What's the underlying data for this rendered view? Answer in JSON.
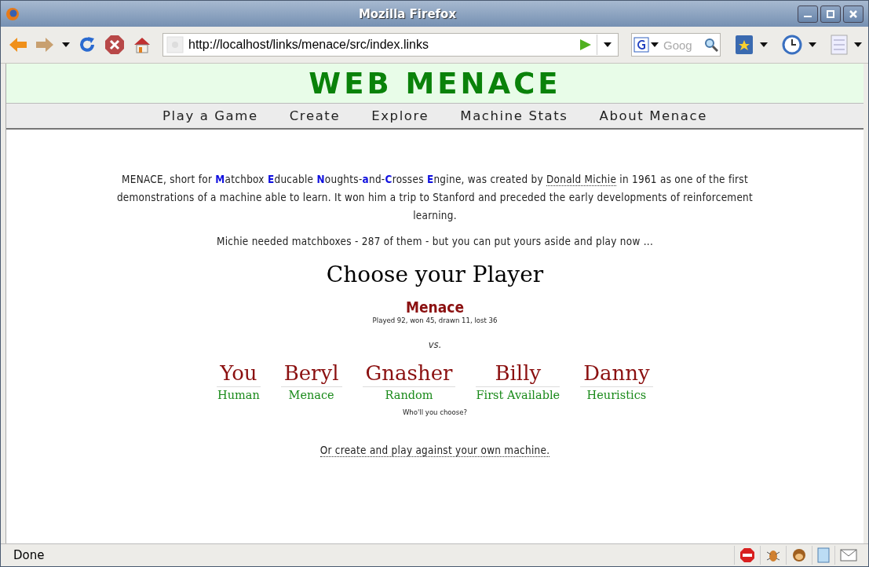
{
  "window": {
    "title": "Mozilla Firefox"
  },
  "toolbar": {
    "url": "http://localhost/links/menace/src/index.links",
    "search_placeholder": "Goog"
  },
  "site": {
    "title": "WEB MENACE"
  },
  "nav": [
    "Play a Game",
    "Create",
    "Explore",
    "Machine Stats",
    "About Menace"
  ],
  "intro": {
    "before": "MENACE, short for **M**atchbox **E**ducable **N**oughts-**a**nd-**C**rosses **E**ngine, was created by",
    "link": "Donald Michie",
    "after": "in 1961 as one of the first demonstrations of a machine able to learn. It won him a trip to Stanford and preceded the early developments of reinforcement learning."
  },
  "note": "Michie needed matchboxes - 287 of them - but you can put yours aside and play now ...",
  "heading": "Choose your Player",
  "machine": {
    "name": "Menace",
    "stats": "Played 92, won 45, drawn 11, lost 36"
  },
  "versus": "vs.",
  "players": [
    {
      "name": "You",
      "type": "Human"
    },
    {
      "name": "Beryl",
      "type": "Menace"
    },
    {
      "name": "Gnasher",
      "type": "Random"
    },
    {
      "name": "Billy",
      "type": "First Available"
    },
    {
      "name": "Danny",
      "type": "Heuristics"
    }
  ],
  "prompt": "Who'll you choose?",
  "create_link": "Or create and play against your own machine.",
  "status_bar": {
    "text": "Done"
  }
}
